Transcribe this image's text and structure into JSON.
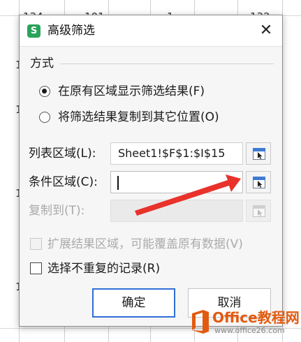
{
  "background_sheet": {
    "top_row_values": [
      "134",
      "101",
      "1",
      "132"
    ],
    "left_edge_fragments": [
      "1",
      "1",
      "1",
      "1"
    ]
  },
  "dialog": {
    "title": "高级筛选",
    "app_icon_letter": "S",
    "close_glyph": "✕",
    "mode_section": {
      "label": "方式",
      "options": [
        {
          "label": "在原有区域显示筛选结果(F)",
          "selected": true
        },
        {
          "label": "将筛选结果复制到其它位置(O)",
          "selected": false
        }
      ]
    },
    "fields": {
      "list_range": {
        "label": "列表区域(L):",
        "value": "Sheet1!$F$1:$I$15",
        "enabled": true
      },
      "criteria_range": {
        "label": "条件区域(C):",
        "value": "",
        "enabled": true,
        "focused": true
      },
      "copy_to": {
        "label": "复制到(T):",
        "value": "",
        "enabled": false
      }
    },
    "checkboxes": {
      "extend": {
        "label": "扩展结果区域，可能覆盖原有数据(V)",
        "checked": false,
        "enabled": false
      },
      "unique": {
        "label": "选择不重复的记录(R)",
        "checked": false,
        "enabled": true
      }
    },
    "buttons": {
      "ok": "确定",
      "cancel": "取消"
    }
  },
  "annotation": {
    "arrow_color": "#e8322b"
  },
  "watermark": {
    "brand": "Office教程网",
    "url": "www.office26.com"
  },
  "colors": {
    "accent": "#2f6fd6",
    "app_icon": "#2aa35a",
    "watermark_orange": "#e25a10"
  }
}
